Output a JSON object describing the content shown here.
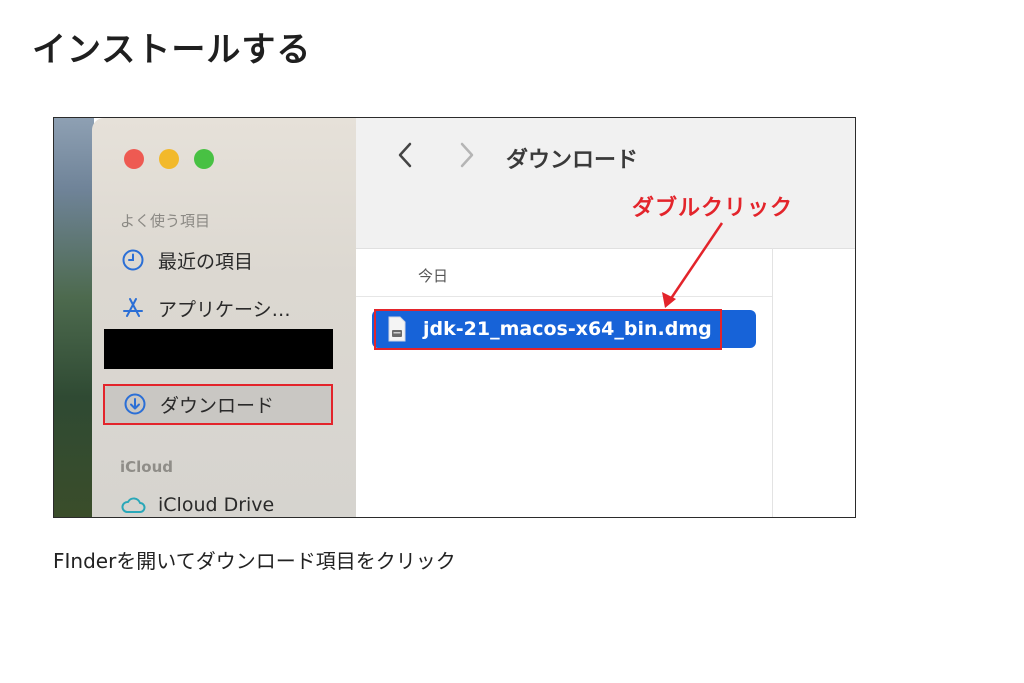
{
  "page": {
    "title": "インストールする",
    "caption": "FInderを開いてダウンロード項目をクリック"
  },
  "finder": {
    "window_title": "ダウンロード",
    "nav": {
      "back_icon": "chevron-left-icon",
      "forward_icon": "chevron-right-icon"
    },
    "traffic_lights": {
      "close": "#ee5a52",
      "minimize": "#f2b92b",
      "zoom": "#48c143"
    },
    "sidebar": {
      "favorites_header": "よく使う項目",
      "items": [
        {
          "label": "最近の項目",
          "icon": "clock-icon"
        },
        {
          "label": "アプリケーシ…",
          "icon": "app-store-icon"
        },
        {
          "label": "ダウンロード",
          "icon": "download-icon",
          "selected": true
        }
      ],
      "icloud_header": "iCloud",
      "icloud_items": [
        {
          "label": "iCloud Drive",
          "icon": "cloud-icon"
        }
      ]
    },
    "group_label": "今日",
    "files": [
      {
        "name": "jdk-21_macos-x64_bin.dmg",
        "icon": "disk-image-icon",
        "selected": true
      }
    ]
  },
  "annotation": {
    "text": "ダブルクリック",
    "color": "#e3242b"
  },
  "colors": {
    "accent": "#1763d8",
    "sidebar_icon": "#2b6fd6",
    "highlight_box": "#e3242b"
  }
}
